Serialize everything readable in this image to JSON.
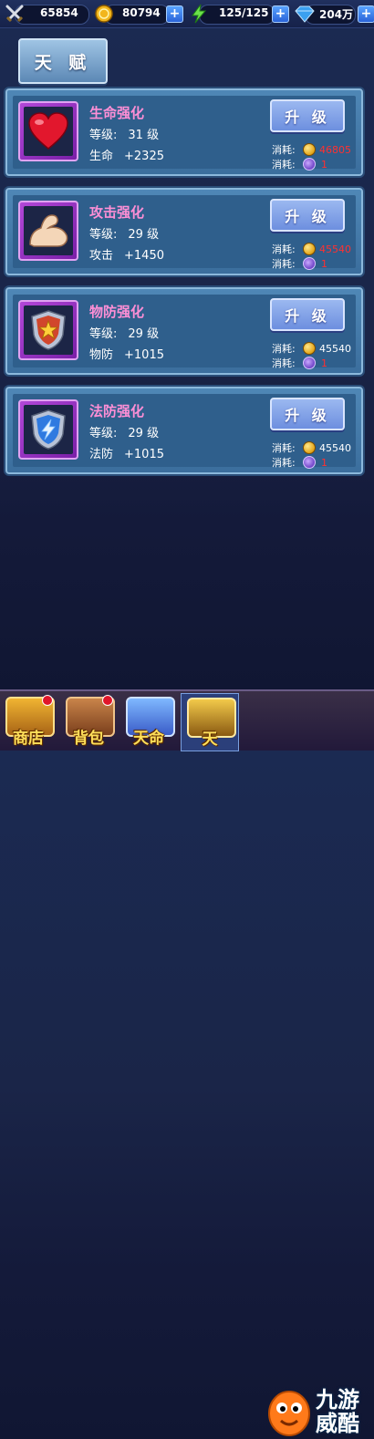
{
  "resources": {
    "power": "65854",
    "gold": "80794",
    "stamina": "125/125",
    "diamond": "204万"
  },
  "tab_title": "天 赋",
  "talents": [
    {
      "name": "生命强化",
      "level_label": "等级:",
      "level_value": "31 级",
      "stat_label": "生命",
      "stat_value": "+2325",
      "button": "升 级",
      "cost_label": "消耗:",
      "gold_cost": "46805",
      "scroll_cost": "1",
      "gold_insufficient": true,
      "icon": "heart-icon"
    },
    {
      "name": "攻击强化",
      "level_label": "等级:",
      "level_value": "29 级",
      "stat_label": "攻击",
      "stat_value": "+1450",
      "button": "升 级",
      "cost_label": "消耗:",
      "gold_cost": "45540",
      "scroll_cost": "1",
      "gold_insufficient": true,
      "icon": "muscle-arm-icon"
    },
    {
      "name": "物防强化",
      "level_label": "等级:",
      "level_value": "29 级",
      "stat_label": "物防",
      "stat_value": "+1015",
      "button": "升 级",
      "cost_label": "消耗:",
      "gold_cost": "45540",
      "scroll_cost": "1",
      "gold_insufficient": false,
      "icon": "star-shield-icon"
    },
    {
      "name": "法防强化",
      "level_label": "等级:",
      "level_value": "29 级",
      "stat_label": "法防",
      "stat_value": "+1015",
      "button": "升 级",
      "cost_label": "消耗:",
      "gold_cost": "45540",
      "scroll_cost": "1",
      "gold_insufficient": false,
      "icon": "lightning-shield-icon"
    }
  ],
  "nav": [
    "商店",
    "背包",
    "天命",
    "天"
  ],
  "watermark": "九游\n威酷",
  "colors": {
    "talent_name": "#ff8fd6",
    "cost_insufficient": "#ff3030",
    "nav_label": "#ffdf5a"
  }
}
